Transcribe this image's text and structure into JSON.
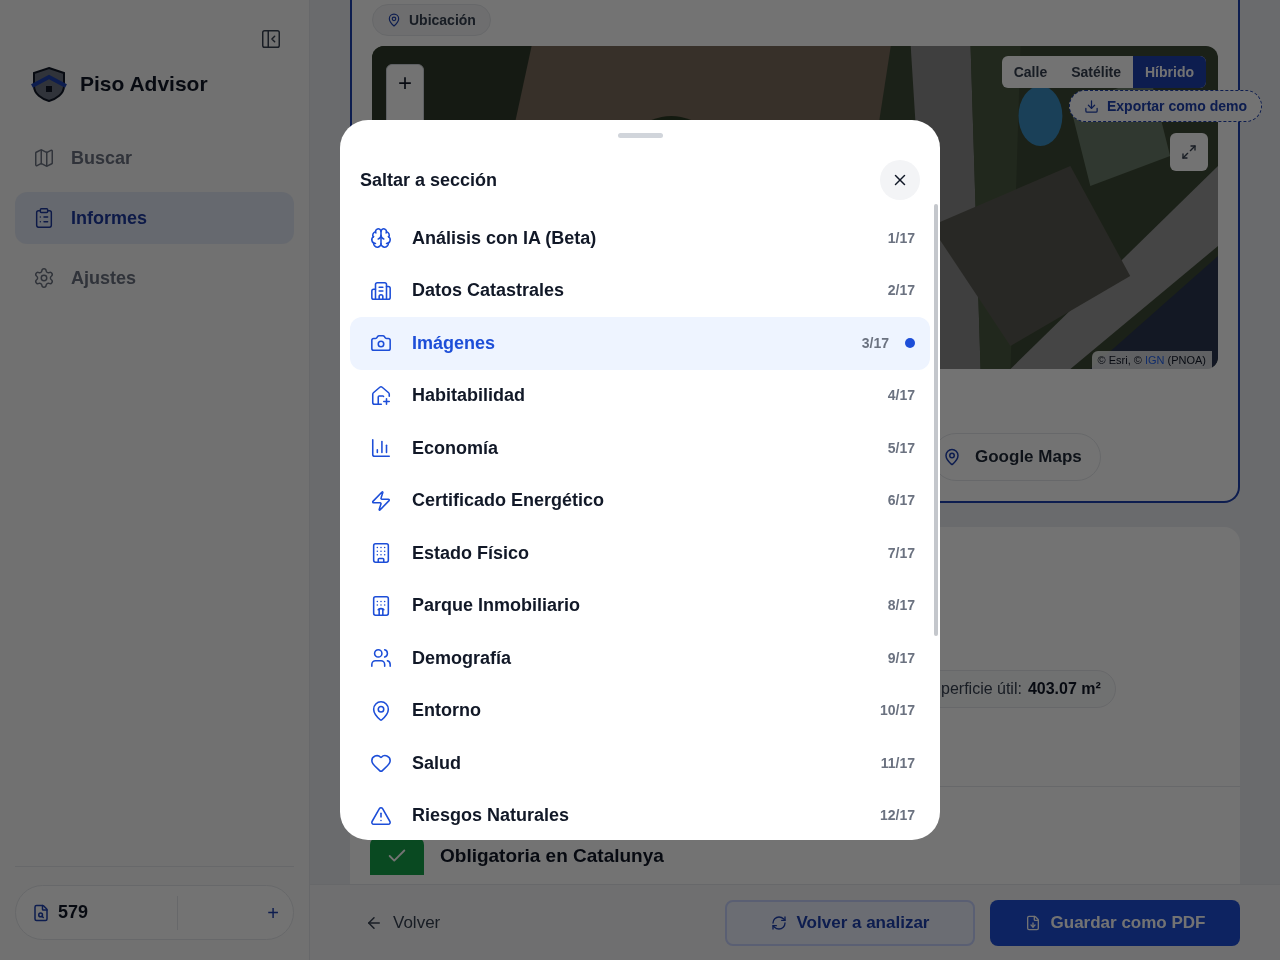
{
  "sidebar": {
    "brand": "Piso Advisor",
    "items": [
      {
        "label": "Buscar",
        "selected": false
      },
      {
        "label": "Informes",
        "selected": true
      },
      {
        "label": "Ajustes",
        "selected": false
      }
    ],
    "credits": {
      "count": "579",
      "add": "+"
    }
  },
  "location_card": {
    "badge": "Ubicación",
    "zoom_in": "+",
    "layers": [
      {
        "label": "Calle",
        "selected": false
      },
      {
        "label": "Satélite",
        "selected": false
      },
      {
        "label": "Híbrido",
        "selected": true
      }
    ],
    "export": "Exportar como demo",
    "attribution": {
      "prefix": "© Esri, ©",
      "link": "IGN",
      "suffix": "(PNOA)"
    },
    "maps_link": "Google Maps"
  },
  "details_card": {
    "area": {
      "label": "perficie útil:",
      "value": "403.07 m²"
    },
    "notice": "Obligatoria en Catalunya"
  },
  "footer": {
    "back": "Volver",
    "reanalyze": "Volver a analizar",
    "save_pdf": "Guardar como PDF"
  },
  "modal": {
    "title": "Saltar a sección",
    "sections": [
      {
        "label": "Análisis con IA (Beta)",
        "counter": "1/17",
        "selected": false
      },
      {
        "label": "Datos Catastrales",
        "counter": "2/17",
        "selected": false
      },
      {
        "label": "Imágenes",
        "counter": "3/17",
        "selected": true
      },
      {
        "label": "Habitabilidad",
        "counter": "4/17",
        "selected": false
      },
      {
        "label": "Economía",
        "counter": "5/17",
        "selected": false
      },
      {
        "label": "Certificado Energético",
        "counter": "6/17",
        "selected": false
      },
      {
        "label": "Estado Físico",
        "counter": "7/17",
        "selected": false
      },
      {
        "label": "Parque Inmobiliario",
        "counter": "8/17",
        "selected": false
      },
      {
        "label": "Demografía",
        "counter": "9/17",
        "selected": false
      },
      {
        "label": "Entorno",
        "counter": "10/17",
        "selected": false
      },
      {
        "label": "Salud",
        "counter": "11/17",
        "selected": false
      },
      {
        "label": "Riesgos Naturales",
        "counter": "12/17",
        "selected": false
      }
    ]
  }
}
